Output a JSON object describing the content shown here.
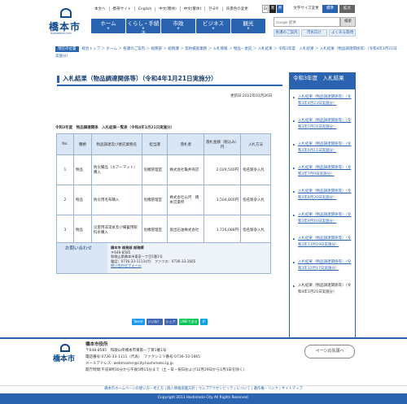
{
  "header": {
    "logo_name": "橋本市",
    "logo_sub": "HASHIMOTO CITY",
    "util_links": [
      "本文へ",
      "携帯サイト",
      "English",
      "中文(簡体)",
      "中文(繁体)",
      "한국어",
      "背景色の変更"
    ],
    "bg_buttons": [
      "白",
      "黒",
      "青"
    ],
    "font_label": "文字サイズ変更",
    "font_buttons": [
      "標準",
      "拡大"
    ],
    "nav": [
      "ホーム",
      "くらし・手続き",
      "市政",
      "ビジネス",
      "観光"
    ],
    "search_placeholder": "Google 提供",
    "search_button": "検索",
    "quick": [
      "各課のご案内",
      "市民向け",
      "よくある質問"
    ]
  },
  "breadcrumb": {
    "here": "現在の位置",
    "path": "総合トップ ＞ ホーム ＞ 各課のご案内 ＞ 総務部 ＞ 総務課 ＞ 契約検査業務 ＞ 入札情報 ＞ 物品・委託 ＞ 入札結果 ＞ 令和3年度　入札結果 ＞ 入札結果（物品調達関係等）（令和4年1月21日実施分）"
  },
  "main": {
    "title": "入札結果（物品調達関係等）（令和4年1月21日実施分）",
    "updated": "更新日:2022年01月26日",
    "intro": "令和3年度　物品調達関係　入札結果一覧表（令和4年1月21日実施分）",
    "headers": [
      "No.",
      "種類",
      "物品調達及び委託業務名",
      "担当課",
      "落札者",
      "落札金額（税込み）円",
      "入札方法"
    ],
    "rows": [
      [
        "1",
        "物品",
        "防災備品（エアーマット）購入",
        "危機管理室",
        "株式会社亀井商店",
        "2,029,500円",
        "指名競争入札"
      ],
      [
        "2",
        "物品",
        "防災用毛布購入",
        "危機管理室",
        "株式会社山河　橋本営業所",
        "1,504,800円",
        "指名競争入札"
      ],
      [
        "3",
        "物品",
        "災害用非常食及び備蓄用飲料水購入",
        "危機管理室",
        "坂出石油株式会社",
        "1,726,088円",
        "指名競争入札"
      ]
    ],
    "inquiry_label": "お問い合わせ",
    "inquiry_lines": [
      "橋本市 総務部 総務課",
      "〒648-8585",
      "和歌山県橋本市東家一丁目1番1号",
      "電話：0736-33-1111(代)　ファクス：0736-33-1665",
      "問い合わせフォーム"
    ]
  },
  "side": {
    "title": "令和3年度　入札結果",
    "items": [
      "入札結果（物品調達関係等）（令和3年4月23日実施分）",
      "入札結果（物品調達関係等）（令和3年5月21日実施分）",
      "入札結果（物品調達関係等）（令和3年6月11日実施分）",
      "入札結果（物品調達関係等）（令和3年7月9日実施分）",
      "入札結果（物品調達関係等）（令和3年8月20日実施分）",
      "入札結果（物品調達関係等）（令和3年9月10日実施分）",
      "入札結果（物品調達関係等）（令和3年11月19日実施分）",
      "入札結果（物品調達関係等）（令和3年12月17日実施分）",
      "入札結果（物品調達関係等）（令和4年1月21日実施分）"
    ]
  },
  "share": [
    "Tweet",
    "いいね！",
    "シェア",
    "LINEで送る",
    "B!"
  ],
  "footer": {
    "name": "橋本市役所",
    "lines": [
      "〒648-8585　和歌山県橋本市東家一丁目1番1号",
      "電話番号:0736-33-1111（代表）　ファクシミリ番号:0736-33-1665",
      "メールアドレス: webmaster@city.hashimoto.lg.jp",
      "開庁時間:午前8時30分から午後5時15分まで（土・日・祝日および12月29日から1月3日を除く）"
    ],
    "pagetop": "ページの先頭へ",
    "links": "橋本市ホームページの使い方・考え方 | 個人情報保護方針 | ウェブアクセシビリティについて | 著作権・リンク | サイトマップ",
    "copyright": "Copyright 2013 Hashimoto City All Rights Reserved."
  },
  "colors": {
    "brand": "#2a64b0",
    "header_cell": "#d9e6f6"
  }
}
